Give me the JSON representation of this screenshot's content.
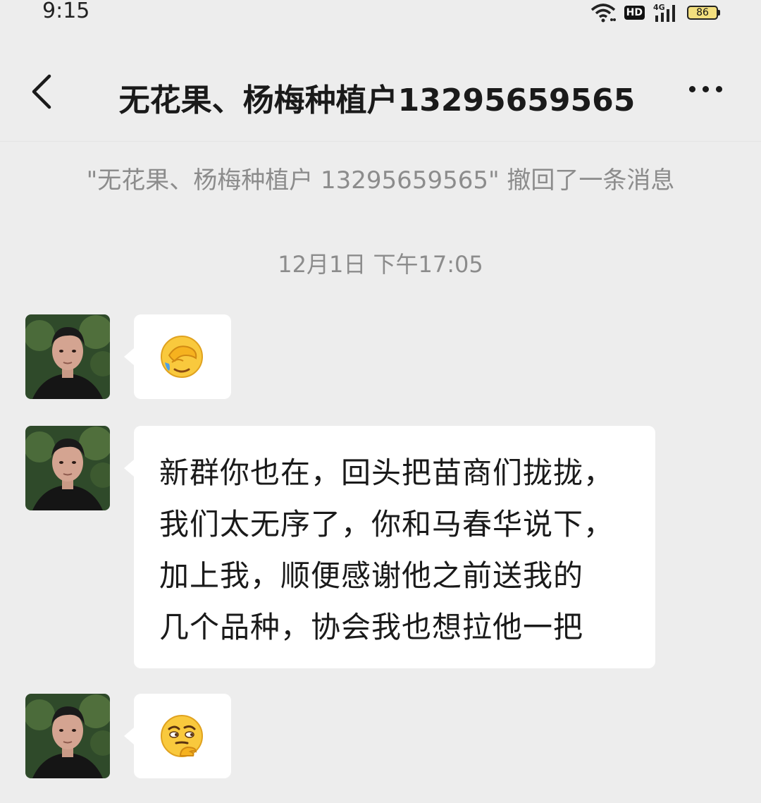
{
  "status_bar": {
    "time": "9:15",
    "hd": "HD",
    "network": "4G",
    "battery": "86"
  },
  "header": {
    "title": "无花果、杨梅种植户13295659565",
    "back_icon": "chevron-left-icon",
    "more_icon": "more-dots-icon"
  },
  "system_notice": "\"无花果、杨梅种植户 13295659565\" 撤回了一条消息",
  "timestamp": "12月1日 下午17:05",
  "messages": [
    {
      "type": "emoji",
      "emoji": "facepalm-emoji"
    },
    {
      "type": "text",
      "text": "新群你也在，回头把苗商们拢拢，\n我们太无序了，你和马春华说下，\n加上我，顺便感谢他之前送我的\n几个品种，协会我也想拉他一把"
    },
    {
      "type": "emoji",
      "emoji": "thinking-emoji"
    }
  ],
  "colors": {
    "background": "#ededed",
    "bubble": "#ffffff",
    "muted_text": "#8c8c8c"
  }
}
